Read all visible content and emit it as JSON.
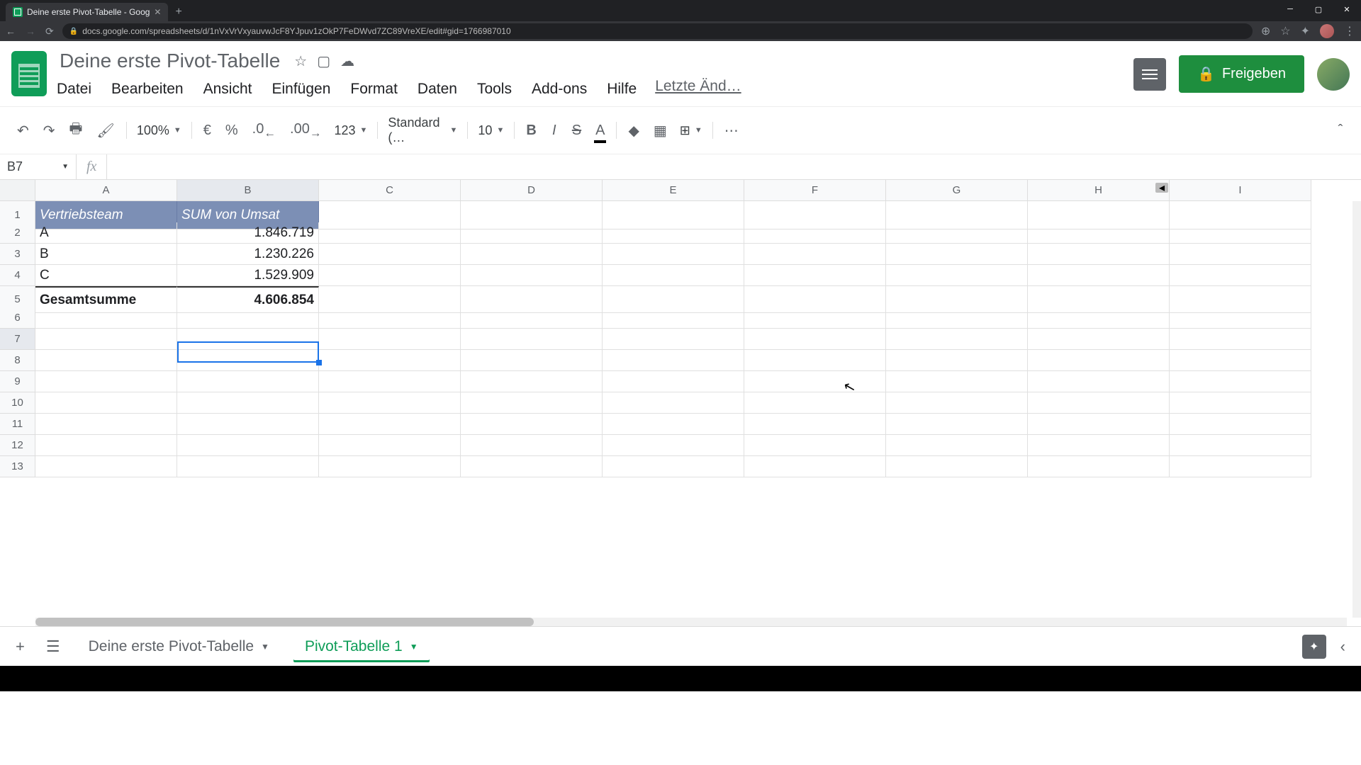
{
  "browser": {
    "tab_title": "Deine erste Pivot-Tabelle - Goog",
    "url": "docs.google.com/spreadsheets/d/1nVxVrVxyauvwJcF8YJpuv1zOkP7FeDWvd7ZC89VreXE/edit#gid=1766987010"
  },
  "doc": {
    "title": "Deine erste Pivot-Tabelle",
    "last_edit": "Letzte Änd…"
  },
  "menu": {
    "file": "Datei",
    "edit": "Bearbeiten",
    "view": "Ansicht",
    "insert": "Einfügen",
    "format": "Format",
    "data": "Daten",
    "tools": "Tools",
    "addons": "Add-ons",
    "help": "Hilfe"
  },
  "share": {
    "label": "Freigeben"
  },
  "toolbar": {
    "zoom": "100%",
    "currency": "€",
    "percent": "%",
    "dec_less": ".0",
    "dec_more": ".00",
    "num_format": "123",
    "font": "Standard (…",
    "font_size": "10",
    "more": "⋯"
  },
  "name_box": "B7",
  "fx": "fx",
  "columns": [
    "A",
    "B",
    "C",
    "D",
    "E",
    "F",
    "G",
    "H",
    "I"
  ],
  "rows": [
    "1",
    "2",
    "3",
    "4",
    "5",
    "6",
    "7",
    "8",
    "9",
    "10",
    "11",
    "12",
    "13"
  ],
  "pivot": {
    "h1": "Vertriebsteam",
    "h2": "SUM von Umsat",
    "r1a": "A",
    "r1b": "1.846.719",
    "r2a": "B",
    "r2b": "1.230.226",
    "r3a": "C",
    "r3b": "1.529.909",
    "tot_a": "Gesamtsumme",
    "tot_b": "4.606.854"
  },
  "selected_cell": "B7",
  "sheets": {
    "tab1": "Deine erste Pivot-Tabelle",
    "tab2": "Pivot-Tabelle 1"
  }
}
